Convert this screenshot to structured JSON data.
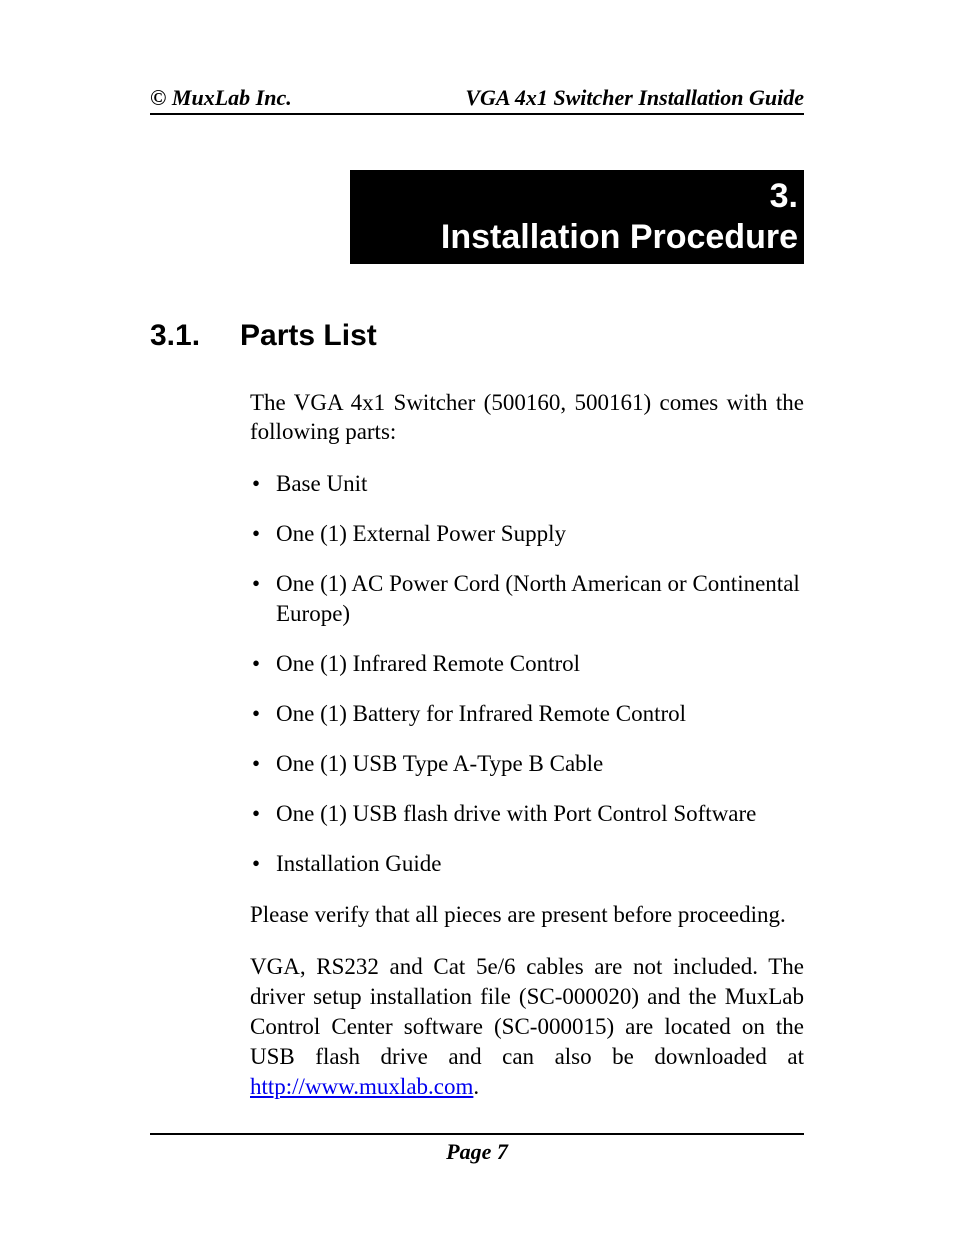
{
  "header": {
    "left": "© MuxLab Inc.",
    "right": "VGA 4x1 Switcher Installation Guide"
  },
  "chapter": {
    "number": "3.",
    "title": "Installation Procedure"
  },
  "section": {
    "number": "3.1.",
    "title": "Parts List"
  },
  "body": {
    "intro": "The VGA 4x1 Switcher (500160, 500161) comes with the following parts:",
    "parts": [
      "Base Unit",
      "One (1) External Power Supply",
      "One (1) AC Power Cord (North American or Continental Europe)",
      "One (1) Infrared Remote Control",
      "One (1) Battery for Infrared Remote Control",
      "One (1) USB Type A-Type B Cable",
      "One (1) USB flash drive with Port Control Software",
      "Installation Guide"
    ],
    "verify": "Please verify that all pieces are present before proceeding.",
    "note_pre": "VGA, RS232 and Cat 5e/6 cables are not included. The driver setup installation file (SC-000020) and the MuxLab Control Center software (SC-000015) are located on the USB flash drive and can also be downloaded at ",
    "note_link": "http://www.muxlab.com",
    "note_post": "."
  },
  "footer": {
    "page": "Page 7"
  }
}
